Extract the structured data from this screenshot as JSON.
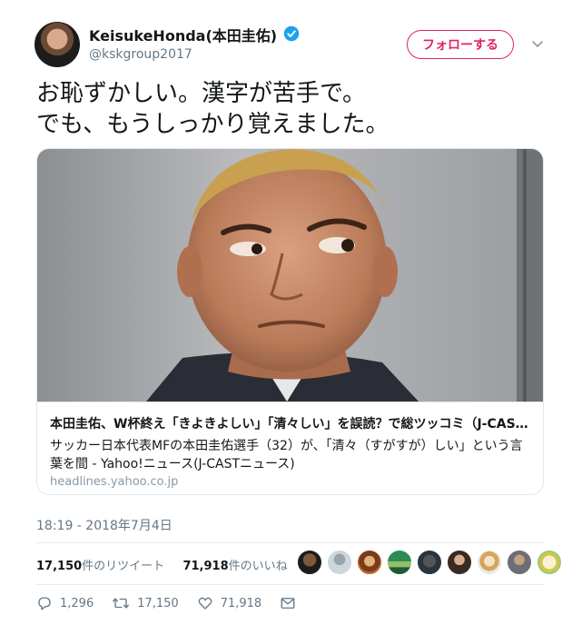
{
  "user": {
    "display_name": "KeisukeHonda(本田圭佑)",
    "handle": "@kskgroup2017",
    "verified": true
  },
  "follow_button": {
    "label": "フォローする",
    "color": "#e0245e"
  },
  "tweet": {
    "lines": [
      "お恥ずかしい。漢字が苦手で。",
      "でも、もうしっかり覚えました。"
    ]
  },
  "card": {
    "title": "本田圭佑、W杯終え「きよきよしい」「清々しい」を誤読？で総ツッコミ（J-CAST…",
    "description": "サッカー日本代表MFの本田圭佑選手（32）が、「清々（すがすが）しい」という言葉を間 - Yahoo!ニュース(J-CASTニュース)",
    "domain": "headlines.yahoo.co.jp"
  },
  "timestamp": "18:19 - 2018年7月4日",
  "stats": {
    "retweets_count": "17,150",
    "retweets_label": "件のリツイート",
    "likes_count": "71,918",
    "likes_label": "件のいいね"
  },
  "actions": {
    "reply_count": "1,296",
    "retweet_count": "17,150",
    "like_count": "71,918"
  },
  "icons": {
    "verified": "verified-badge-icon",
    "caret": "chevron-down-icon",
    "reply": "reply-icon",
    "retweet": "retweet-icon",
    "like": "heart-icon",
    "dm": "envelope-icon"
  },
  "colors": {
    "link_blue": "#1da1f2",
    "muted_text": "#657786",
    "border": "#e1e8ed"
  }
}
